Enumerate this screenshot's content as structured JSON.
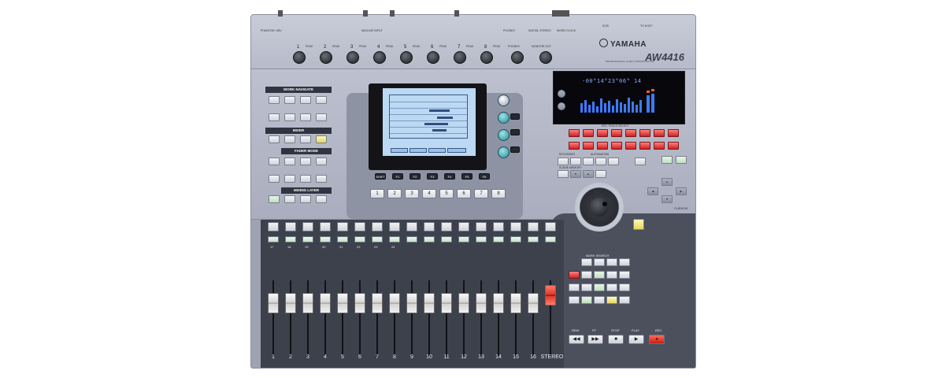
{
  "brand": "YAMAHA",
  "model": "AW4416",
  "subtitle": "PROFESSIONAL AUDIO WORKSTATION",
  "inputs": {
    "label": "MIC/LINE INPUT",
    "phantom_label": "PHANTOM +48V",
    "peak_label": "PEAK",
    "channels": [
      "1",
      "2",
      "3",
      "4",
      "5",
      "6",
      "7",
      "8"
    ]
  },
  "outputs": {
    "phones": "PHONES",
    "monitor_out": "MONITOR OUT",
    "digital_stereo": "DIGITAL STEREO",
    "word_clock": "WORD CLOCK",
    "scsi": "SCSI",
    "to_host": "TO HOST"
  },
  "work_navigate": {
    "title": "WORK NAVIGATE",
    "mixer_title": "MIXER",
    "fader_mode_title": "FADER MODE",
    "mixing_layer_title": "MIXING LAYER"
  },
  "display": {
    "time_readout": "-00°14°23°06° 14",
    "function_keys": [
      "SHIFT",
      "F1",
      "F2",
      "F3",
      "F4",
      "F5",
      "F6"
    ],
    "number_keys": [
      "1",
      "2",
      "3",
      "4",
      "5",
      "6",
      "7",
      "8"
    ]
  },
  "rec_track_select": {
    "title": "REC TRACK SELECT"
  },
  "recorder": {
    "title": "RECORDER",
    "automation_title": "AUTOMATION",
    "scene_memory_title": "SCENE MEMORY"
  },
  "mark_search": "MARK SEARCH",
  "cursor_label": "CURSOR",
  "transport": {
    "rew": "REW",
    "ff": "FF",
    "stop": "STOP",
    "play": "PLAY",
    "rec": "REC"
  },
  "strip_channels": [
    "17",
    "18",
    "19",
    "20",
    "21",
    "22",
    "23",
    "24"
  ],
  "channels": [
    "1",
    "2",
    "3",
    "4",
    "5",
    "6",
    "7",
    "8",
    "9",
    "10",
    "11",
    "12",
    "13",
    "14",
    "15",
    "16"
  ],
  "stereo_label": "STEREO",
  "colors": {
    "lcd_blue": "#bcd8f2",
    "meter_blue": "#8fa8ff",
    "rec_red": "#d02020",
    "encoder_teal": "#2a8c96",
    "deck_dark": "#3c414c"
  }
}
